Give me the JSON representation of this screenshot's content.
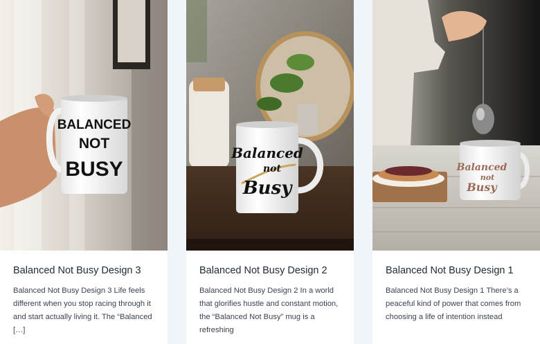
{
  "posts": [
    {
      "title": "Balanced Not Busy Design 3",
      "excerpt": "Balanced Not Busy Design 3 Life feels different when you stop racing through it and start actually living it. The “Balanced […]",
      "mug_lines": [
        "BALANCED",
        "NOT",
        "BUSY"
      ]
    },
    {
      "title": "Balanced Not Busy Design 2",
      "excerpt": "Balanced Not Busy Design 2 In a world that glorifies hustle and constant motion, the “Balanced Not Busy” mug is a refreshing",
      "mug_lines": [
        "Balanced",
        "not",
        "Busy"
      ]
    },
    {
      "title": "Balanced Not Busy Design 1",
      "excerpt": "Balanced Not Busy Design 1 There’s a peaceful kind of power that comes from choosing a life of intention instead",
      "mug_lines": [
        "Balanced",
        "not",
        "Busy"
      ]
    }
  ]
}
